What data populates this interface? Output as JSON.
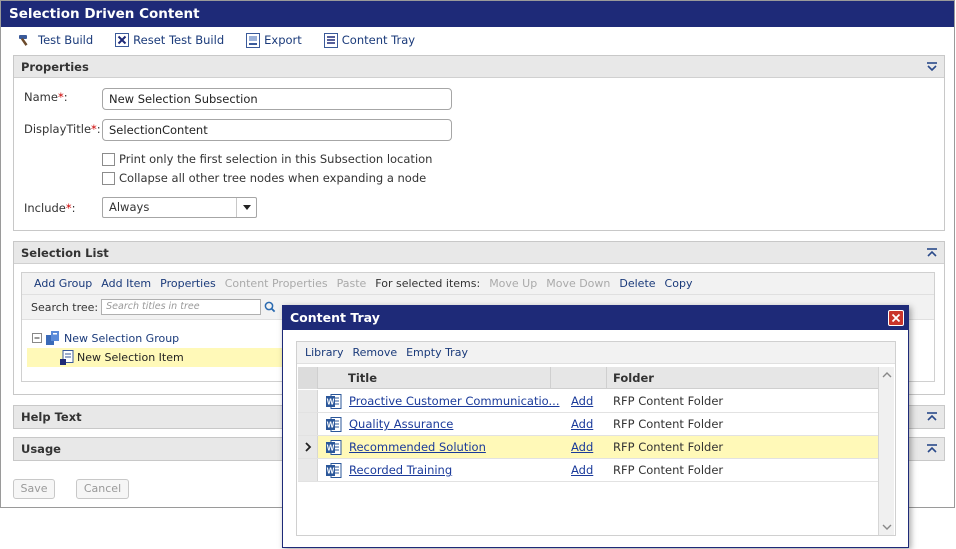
{
  "window": {
    "title": "Selection Driven Content"
  },
  "toolbar": {
    "test_build": "Test Build",
    "reset_test_build": "Reset Test Build",
    "export": "Export",
    "content_tray": "Content Tray"
  },
  "properties": {
    "title": "Properties",
    "name_label": "Name",
    "name_value": "New Selection Subsection",
    "display_title_label": "DisplayTitle",
    "display_title_value": "SelectionContent",
    "required_mark": "*",
    "label_colon": ":",
    "checkbox1_label": "Print only the first selection in this Subsection location",
    "checkbox2_label": "Collapse all other tree nodes when expanding a node",
    "include_label": "Include",
    "include_value": "Always"
  },
  "selection_list": {
    "title": "Selection List",
    "actions": {
      "add_group": "Add Group",
      "add_item": "Add Item",
      "properties": "Properties",
      "content_properties": "Content Properties",
      "paste": "Paste",
      "for_selected": "For selected items:",
      "move_up": "Move Up",
      "move_down": "Move Down",
      "delete": "Delete",
      "copy": "Copy"
    },
    "search_label": "Search tree:",
    "search_placeholder": "Search titles in tree",
    "tree": {
      "group": "New Selection Group",
      "item": "New Selection Item"
    }
  },
  "help_text": {
    "title": "Help Text"
  },
  "usage": {
    "title": "Usage"
  },
  "footer": {
    "save": "Save",
    "cancel": "Cancel"
  },
  "content_tray": {
    "title": "Content Tray",
    "actions": {
      "library": "Library",
      "remove": "Remove",
      "empty_tray": "Empty Tray"
    },
    "columns": {
      "title": "Title",
      "folder": "Folder"
    },
    "rows": [
      {
        "title": "Proactive Customer Communicatio...",
        "add": "Add",
        "folder": "RFP Content Folder"
      },
      {
        "title": "Quality Assurance",
        "add": "Add",
        "folder": "RFP Content Folder"
      },
      {
        "title": "Recommended Solution",
        "add": "Add",
        "folder": "RFP Content Folder"
      },
      {
        "title": "Recorded Training",
        "add": "Add",
        "folder": "RFP Content Folder"
      }
    ],
    "selected_row": 2
  },
  "colors": {
    "titlebar": "#1e2a78",
    "link": "#1a3a7a",
    "required": "#cc0000",
    "selected_row": "#fff9b8",
    "close_button": "#c9342a"
  }
}
